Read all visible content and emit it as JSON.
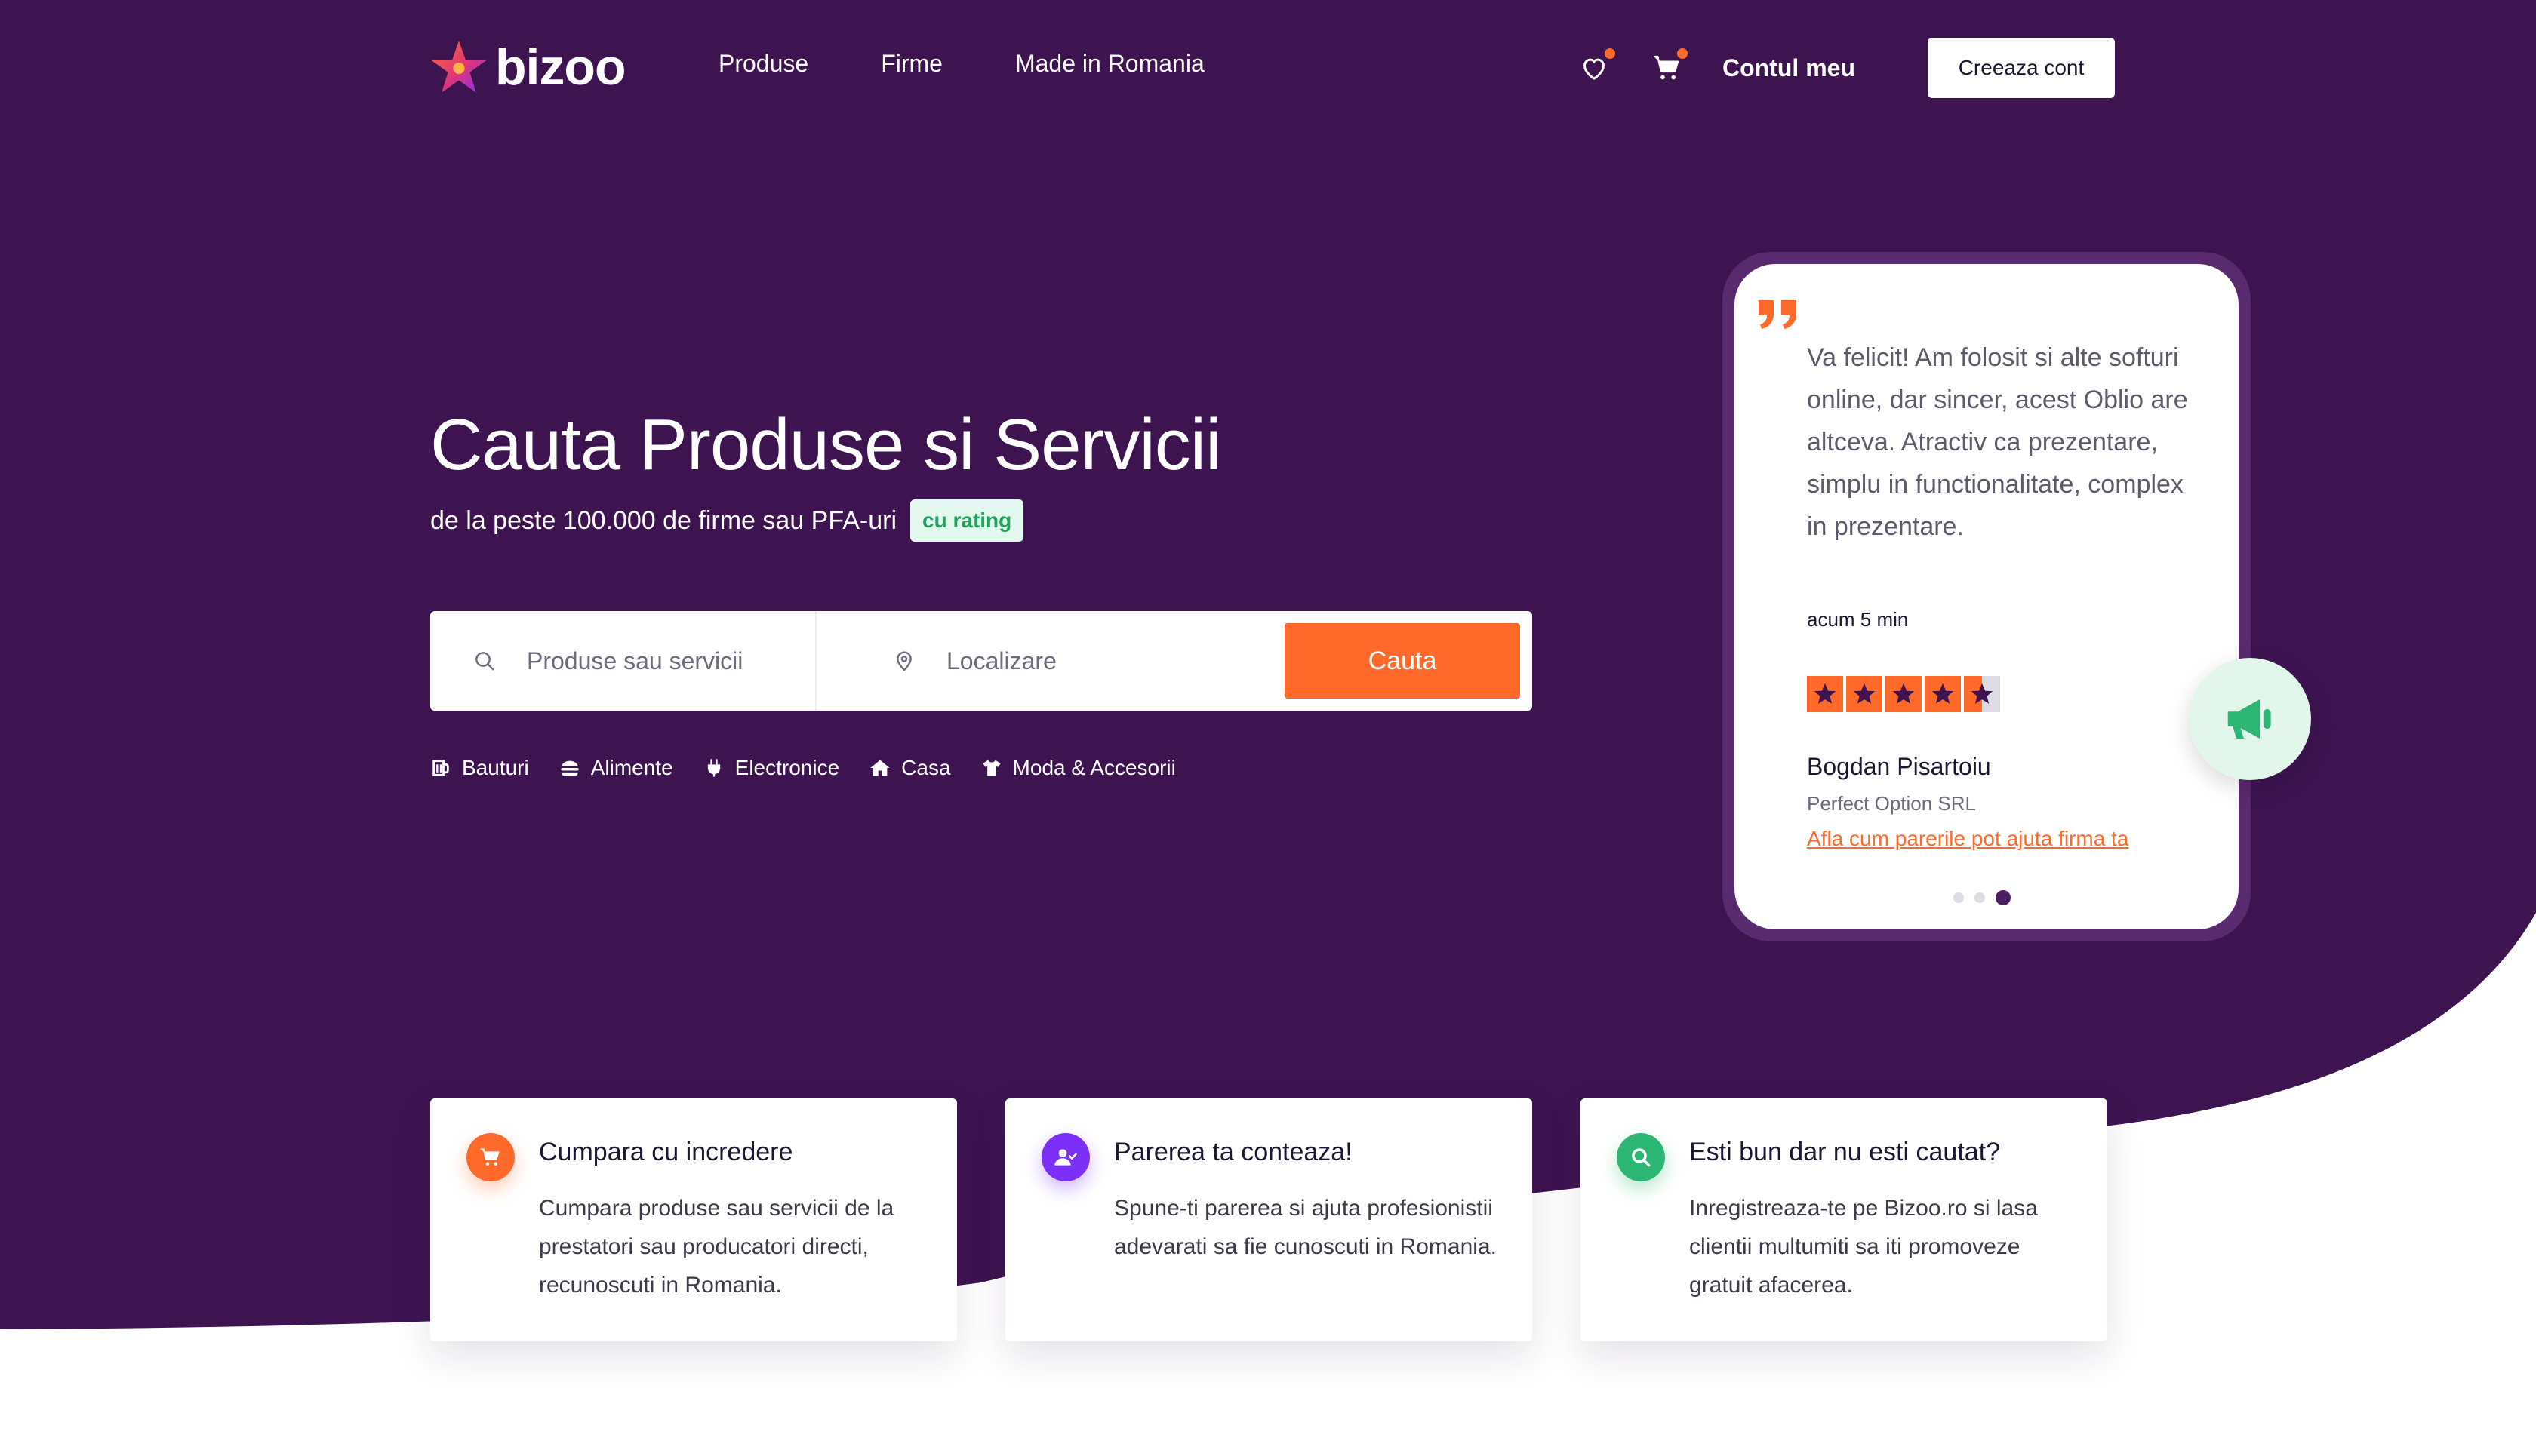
{
  "brand": {
    "name": "bizoo"
  },
  "nav": {
    "items": [
      "Produse",
      "Firme",
      "Made in Romania"
    ],
    "account_label": "Contul meu",
    "create_account_label": "Creeaza cont"
  },
  "hero": {
    "title": "Cauta Produse si Servicii",
    "subtitle": "de la peste 100.000 de firme sau PFA-uri",
    "badge": "cu rating"
  },
  "search": {
    "products_placeholder": "Produse sau servicii",
    "location_placeholder": "Localizare",
    "button_label": "Cauta"
  },
  "categories": [
    {
      "label": "Bauturi",
      "icon": "beer-mug-icon"
    },
    {
      "label": "Alimente",
      "icon": "burger-icon"
    },
    {
      "label": "Electronice",
      "icon": "plug-icon"
    },
    {
      "label": "Casa",
      "icon": "home-icon"
    },
    {
      "label": "Moda & Accesorii",
      "icon": "tshirt-icon"
    }
  ],
  "testimonial": {
    "text": "Va felicit! Am folosit si alte softuri online, dar sincer, acest Oblio are altceva. Atractiv ca prezentare, simplu in functionalitate, complex in prezentare.",
    "time": "acum 5 min",
    "rating": 4.5,
    "rating_max": 5,
    "author": "Bogdan Pisartoiu",
    "company": "Perfect Option SRL",
    "link_text": "Afla cum parerile pot ajuta firma ta",
    "slides": 3,
    "active_slide": 3
  },
  "features": [
    {
      "title": "Cumpara cu incredere",
      "text": "Cumpara produse sau servicii de la prestatori sau producatori directi, recunoscuti in Romania.",
      "icon": "cart-icon",
      "color": "#ff6a2b"
    },
    {
      "title": "Parerea ta conteaza!",
      "text": "Spune-ti parerea si ajuta profesionistii adevarati sa fie cunoscuti in Romania.",
      "icon": "user-check-icon",
      "color": "#7b2ff7"
    },
    {
      "title": "Esti bun dar nu esti cautat?",
      "text": "Inregistreaza-te pe Bizoo.ro si lasa clientii multumiti sa iti promoveze gratuit afacerea.",
      "icon": "search-icon",
      "color": "#2bb673"
    }
  ],
  "colors": {
    "hero_bg": "#3d1450",
    "accent": "#ff6a2b",
    "badge_bg": "#e3f8ee",
    "badge_text": "#21a35d",
    "megaphone": "#2bb673"
  }
}
